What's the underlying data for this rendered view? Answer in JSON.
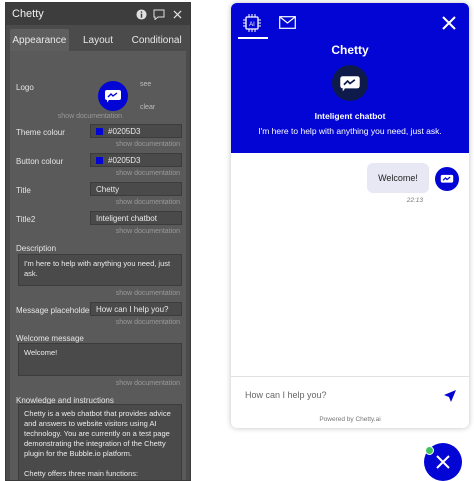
{
  "panel": {
    "title": "Chetty",
    "tabs": [
      "Appearance",
      "Layout",
      "Conditional"
    ],
    "show_doc": "show documentation",
    "logo": {
      "label": "Logo",
      "see": "see",
      "clear": "clear"
    },
    "theme_colour": {
      "label": "Theme colour",
      "value": "#0205D3"
    },
    "button_colour": {
      "label": "Button colour",
      "value": "#0205D3"
    },
    "title_field": {
      "label": "Title",
      "value": "Chetty"
    },
    "title2_field": {
      "label": "Title2",
      "value": "Inteligent chatbot"
    },
    "description": {
      "label": "Description",
      "value": "I'm here to help with anything you need, just ask."
    },
    "placeholder": {
      "label": "Message placeholder",
      "value": "How can I help you?"
    },
    "welcome": {
      "label": "Welcome message",
      "value": "Welcome!"
    },
    "knowledge": {
      "label": "Knowledge and instructions",
      "value": "Chetty is a web chatbot that provides advice and answers to website visitors using AI technology. You are currently on a test page demonstrating the integration of the Chetty plugin for the Bubble.io platform.\n\nChetty offers three main functions:\n\nBrowsing Web Content: The chatbot can browse website content and provide relevant responses."
    }
  },
  "chat": {
    "title": "Chetty",
    "subtitle": "Inteligent chatbot",
    "intro": "I'm here to help with anything you need, just ask.",
    "messages": [
      {
        "text": "Welcome!",
        "time": "22:13"
      }
    ],
    "input_placeholder": "How can I help you?",
    "powered": "Powered by Chetty.ai",
    "head_icons": [
      "ai-chip-icon",
      "mail-icon"
    ]
  },
  "colors": {
    "brand": "#0205D3",
    "online": "#43c15a"
  }
}
